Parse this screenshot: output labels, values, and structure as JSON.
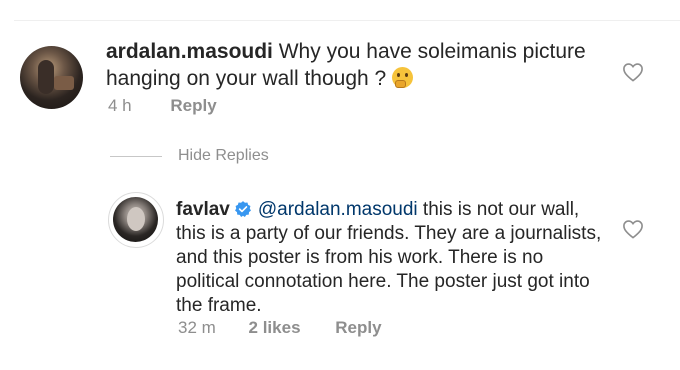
{
  "comments": [
    {
      "username": "ardalan.masoudi",
      "text": "Why you have soleimanis picture hanging on your wall though ?",
      "emoji_name": "thinking-face-emoji",
      "time": "4 h",
      "reply_label": "Reply"
    },
    {
      "username": "favlav",
      "mention": "@ardalan.masoudi",
      "text": "this is not our wall, this is a party of our friends. They are a journalists, and this poster is from his work. There is no political connotation here. The poster just got into the frame.",
      "time": "32 m",
      "likes": "2 likes",
      "reply_label": "Reply"
    }
  ],
  "hide_replies_label": "Hide Replies",
  "icons": {
    "like": "heart-outline-icon",
    "verified": "verified-badge-icon"
  },
  "colors": {
    "text": "#262626",
    "muted": "#8e8e8e",
    "verified": "#3897f0",
    "mention": "#00376b"
  }
}
